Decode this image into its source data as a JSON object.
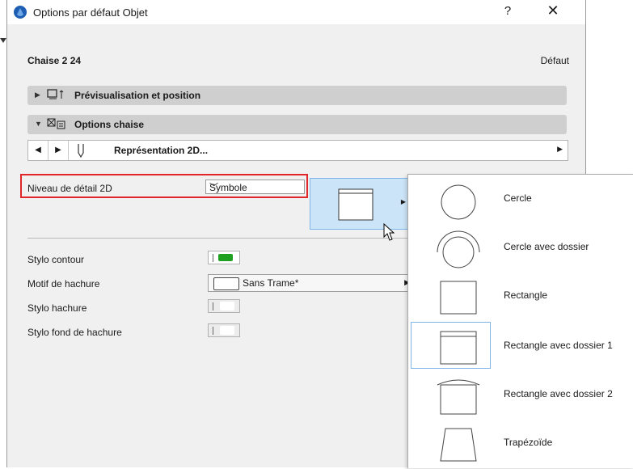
{
  "window": {
    "title": "Options par défaut Objet",
    "help_label": "?",
    "close_label": "✕"
  },
  "header": {
    "object_name": "Chaise 2 24",
    "default_label": "Défaut"
  },
  "sections": [
    {
      "label": "Prévisualisation et position",
      "expanded": false
    },
    {
      "label": "Options chaise",
      "expanded": true
    }
  ],
  "subpage_nav": {
    "label": "Représentation 2D..."
  },
  "detail": {
    "label": "Niveau de détail 2D",
    "value": "Symbole"
  },
  "props": {
    "contour_pen_label": "Stylo contour",
    "hatch_pattern_label": "Motif de hachure",
    "hatch_pattern_value": "Sans Trame*",
    "hatch_pen_label": "Stylo hachure",
    "hatch_bg_pen_label": "Stylo fond de hachure"
  },
  "colors": {
    "contour_pen": "#20a020",
    "highlight": "#e0262a",
    "selection": "#cce4f7"
  },
  "menu": {
    "items": [
      {
        "label": "Cercle",
        "shape": "circle"
      },
      {
        "label": "Cercle avec dossier",
        "shape": "circle-back"
      },
      {
        "label": "Rectangle",
        "shape": "rect"
      },
      {
        "label": "Rectangle avec dossier 1",
        "shape": "rect-back1",
        "selected": true
      },
      {
        "label": "Rectangle avec dossier 2",
        "shape": "rect-back2"
      },
      {
        "label": "Trapézoïde",
        "shape": "trapezoid"
      }
    ]
  }
}
